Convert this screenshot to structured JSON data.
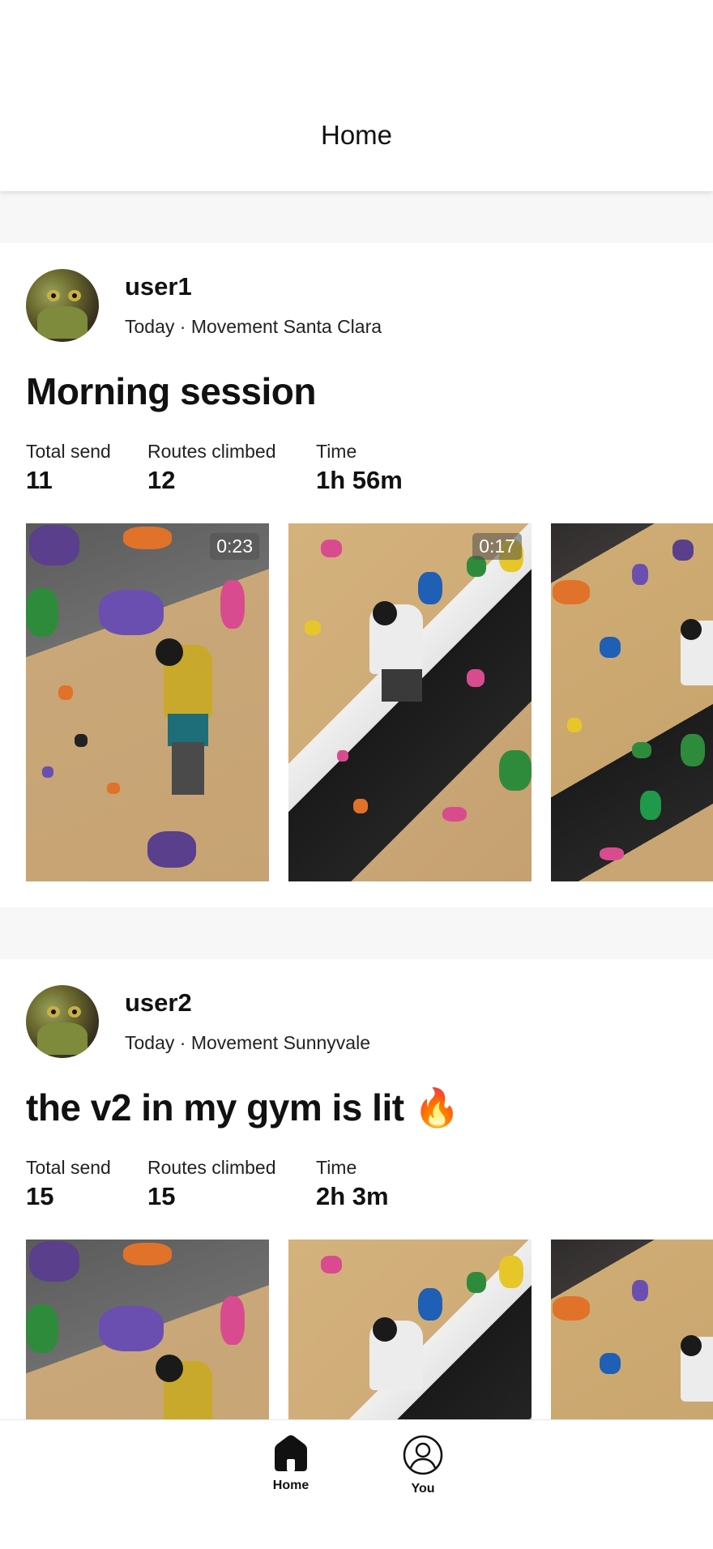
{
  "header": {
    "title": "Home"
  },
  "posts": [
    {
      "username": "user1",
      "meta": "Today · Movement Santa Clara",
      "title": "Morning session",
      "stats": [
        {
          "label": "Total send",
          "value": "11"
        },
        {
          "label": "Routes climbed",
          "value": "12"
        },
        {
          "label": "Time",
          "value": "1h 56m"
        }
      ],
      "media": [
        {
          "duration": "0:23"
        },
        {
          "duration": "0:17"
        },
        {
          "duration": ""
        }
      ]
    },
    {
      "username": "user2",
      "meta": "Today · Movement Sunnyvale",
      "title": "the v2 in my gym is lit",
      "title_emoji": "🔥",
      "stats": [
        {
          "label": "Total send",
          "value": "15"
        },
        {
          "label": "Routes climbed",
          "value": "15"
        },
        {
          "label": "Time",
          "value": "2h 3m"
        }
      ],
      "media": [
        {
          "duration": ""
        },
        {
          "duration": ""
        },
        {
          "duration": ""
        }
      ]
    }
  ],
  "tabbar": {
    "items": [
      {
        "label": "Home",
        "icon": "home-icon",
        "active": true
      },
      {
        "label": "You",
        "icon": "profile-icon",
        "active": false
      }
    ]
  }
}
